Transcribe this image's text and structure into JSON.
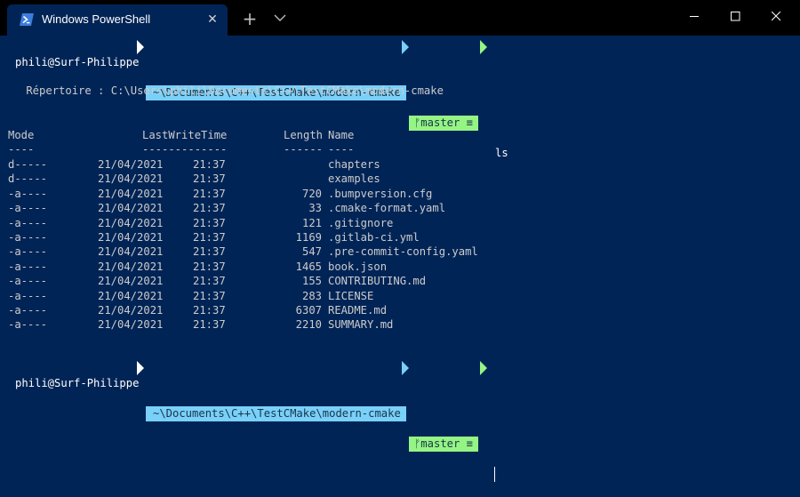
{
  "window": {
    "tab_title": "Windows PowerShell",
    "tab_close": "✕",
    "new_tab": "+"
  },
  "prompt": {
    "user": "phili@Surf-Philippe",
    "path": "~\\Documents\\C++\\TestCMake\\modern-cmake",
    "branch": "ᚠmaster ≡",
    "command": "ls"
  },
  "listing": {
    "directory": "    Répertoire : C:\\Users\\phili\\Documents\\C++\\TestCMake\\modern-cmake",
    "headers": {
      "mode": "Mode",
      "time": "LastWriteTime",
      "length": "Length",
      "name": "Name"
    },
    "underlines": {
      "mode": "----",
      "time": "-------------",
      "length": "------",
      "name": "----"
    },
    "rows": [
      {
        "mode": "d-----",
        "date": "21/04/2021",
        "time": "21:37",
        "length": "",
        "name": "chapters"
      },
      {
        "mode": "d-----",
        "date": "21/04/2021",
        "time": "21:37",
        "length": "",
        "name": "examples"
      },
      {
        "mode": "-a----",
        "date": "21/04/2021",
        "time": "21:37",
        "length": "720",
        "name": ".bumpversion.cfg"
      },
      {
        "mode": "-a----",
        "date": "21/04/2021",
        "time": "21:37",
        "length": "33",
        "name": ".cmake-format.yaml"
      },
      {
        "mode": "-a----",
        "date": "21/04/2021",
        "time": "21:37",
        "length": "121",
        "name": ".gitignore"
      },
      {
        "mode": "-a----",
        "date": "21/04/2021",
        "time": "21:37",
        "length": "1169",
        "name": ".gitlab-ci.yml"
      },
      {
        "mode": "-a----",
        "date": "21/04/2021",
        "time": "21:37",
        "length": "547",
        "name": ".pre-commit-config.yaml"
      },
      {
        "mode": "-a----",
        "date": "21/04/2021",
        "time": "21:37",
        "length": "1465",
        "name": "book.json"
      },
      {
        "mode": "-a----",
        "date": "21/04/2021",
        "time": "21:37",
        "length": "155",
        "name": "CONTRIBUTING.md"
      },
      {
        "mode": "-a----",
        "date": "21/04/2021",
        "time": "21:37",
        "length": "283",
        "name": "LICENSE"
      },
      {
        "mode": "-a----",
        "date": "21/04/2021",
        "time": "21:37",
        "length": "6307",
        "name": "README.md"
      },
      {
        "mode": "-a----",
        "date": "21/04/2021",
        "time": "21:37",
        "length": "2210",
        "name": "SUMMARY.md"
      }
    ]
  },
  "colors": {
    "background": "#012456",
    "titlebar": "#000000",
    "path_segment": "#79d0f8",
    "git_segment": "#95f584",
    "text": "#cccccc"
  },
  "icons": {
    "tab": "powershell-icon",
    "dropdown": "chevron-down-icon",
    "minimize": "minimize-icon",
    "maximize": "maximize-icon",
    "close": "close-icon"
  }
}
